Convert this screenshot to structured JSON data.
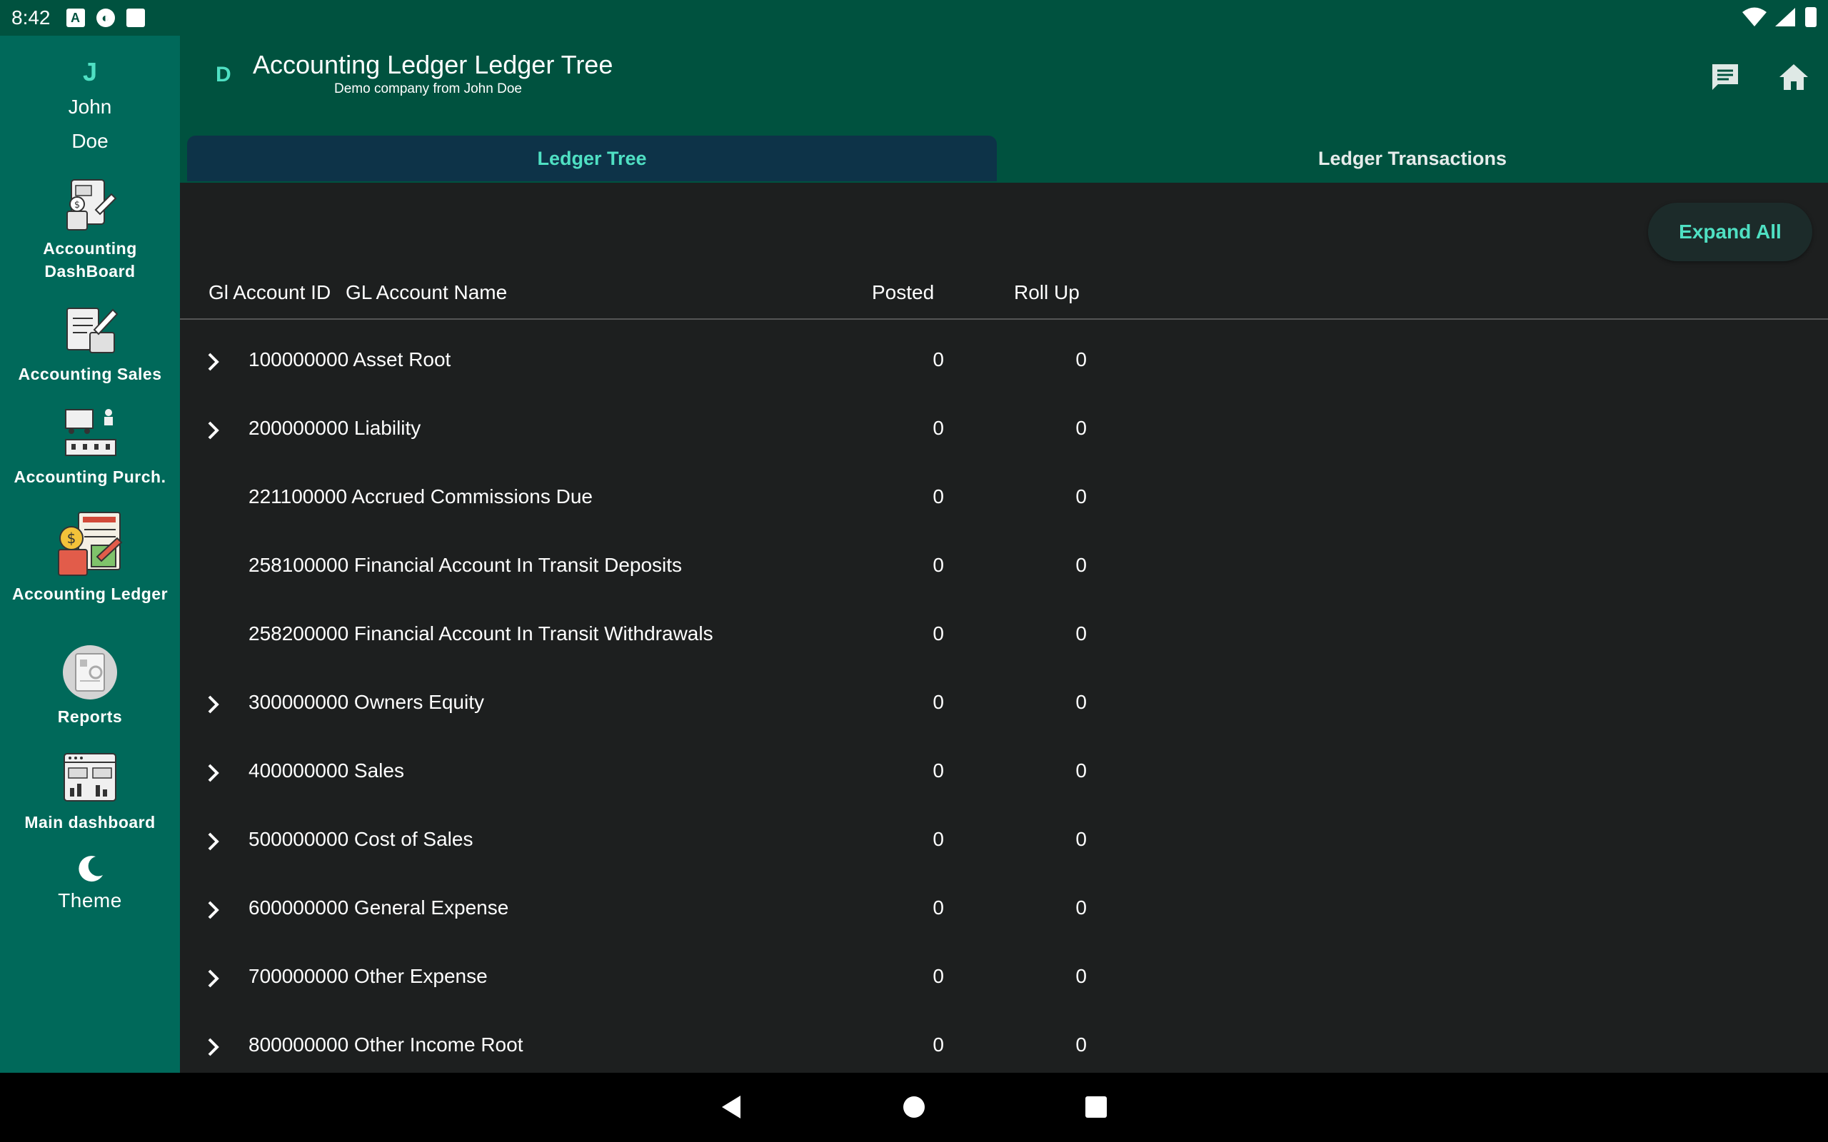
{
  "status": {
    "time": "8:42"
  },
  "user": {
    "initial": "J",
    "first": "John",
    "last": "Doe"
  },
  "sidebar": {
    "items": [
      {
        "line1": "Accounting",
        "line2": "DashBoard"
      },
      {
        "line1": "Accounting Sales",
        "line2": ""
      },
      {
        "line1": "Accounting Purch.",
        "line2": ""
      },
      {
        "line1": "Accounting Ledger",
        "line2": ""
      },
      {
        "line1": "Reports",
        "line2": ""
      },
      {
        "line1": "Main dashboard",
        "line2": ""
      }
    ],
    "theme_label": "Theme"
  },
  "appbar": {
    "company_initial": "D",
    "title": "Accounting Ledger  Ledger Tree",
    "subtitle": "Demo company from John Doe"
  },
  "tabs": [
    {
      "label": "Ledger Tree"
    },
    {
      "label": "Ledger Transactions"
    }
  ],
  "toolbar": {
    "expand_all": "Expand All"
  },
  "table": {
    "headers": {
      "id": "Gl Account ID",
      "name": "GL Account Name",
      "posted": "Posted",
      "rollup": "Roll Up"
    },
    "rows": [
      {
        "label": "100000000 Asset Root",
        "posted": "0",
        "rollup": "0",
        "expandable": true
      },
      {
        "label": "200000000 Liability",
        "posted": "0",
        "rollup": "0",
        "expandable": true
      },
      {
        "label": "221100000 Accrued Commissions Due",
        "posted": "0",
        "rollup": "0",
        "expandable": false
      },
      {
        "label": "258100000 Financial Account In Transit Deposits",
        "posted": "0",
        "rollup": "0",
        "expandable": false
      },
      {
        "label": "258200000 Financial Account In Transit Withdrawals",
        "posted": "0",
        "rollup": "0",
        "expandable": false
      },
      {
        "label": "300000000 Owners Equity",
        "posted": "0",
        "rollup": "0",
        "expandable": true
      },
      {
        "label": "400000000 Sales",
        "posted": "0",
        "rollup": "0",
        "expandable": true
      },
      {
        "label": "500000000 Cost of Sales",
        "posted": "0",
        "rollup": "0",
        "expandable": true
      },
      {
        "label": "600000000 General Expense",
        "posted": "0",
        "rollup": "0",
        "expandable": true
      },
      {
        "label": "700000000 Other Expense",
        "posted": "0",
        "rollup": "0",
        "expandable": true
      },
      {
        "label": "800000000 Other Income Root",
        "posted": "0",
        "rollup": "0",
        "expandable": true
      }
    ]
  },
  "colors": {
    "appbar_bg": "#00523f",
    "sidebar_bg": "#00695a",
    "accent": "#4fe0c3",
    "content_bg": "#1d1f1f",
    "active_tab_bg": "#0d3348"
  }
}
